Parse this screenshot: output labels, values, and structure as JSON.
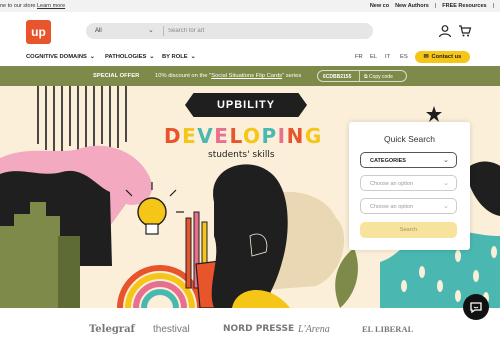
{
  "topbar": {
    "welcome": "ne to our store",
    "learn_more": "Learn more",
    "links": [
      "New co",
      "New Authors",
      "|",
      "FREE Resources",
      "|"
    ]
  },
  "header": {
    "logo": "up",
    "search": {
      "category": "All",
      "placeholder": "Search for art"
    },
    "icons": [
      "chevron-down-icon",
      "user-icon",
      "cart-icon"
    ]
  },
  "nav": {
    "items": [
      "COGNITIVE DOMAINS",
      "PATHOLOGIES",
      "BY ROLE"
    ],
    "languages": [
      "FR",
      "EL",
      "IT",
      "ES"
    ],
    "contact": "Contact us"
  },
  "offer": {
    "label": "SPECIAL OFFER",
    "text_prefix": "10% discount on the \"",
    "text_link": "Social Situations Flip Cards",
    "text_suffix": "\" series",
    "code": "6CDBB2155",
    "copy": "Copy code"
  },
  "hero": {
    "badge": "UPBILITY",
    "headline": "DEVELOPING",
    "subline": "students' skills",
    "headline_colors": [
      "#e8542c",
      "#f5c518",
      "#4bb7b1",
      "#e86f8e",
      "#e8542c",
      "#f5c518",
      "#4bb7b1",
      "#e86f8e",
      "#e8542c",
      "#f5c518"
    ]
  },
  "quick_search": {
    "title": "Quick Search",
    "category": "CATEGORIES",
    "option_1": "Choose an option",
    "option_2": "Choose an option",
    "button": "Search"
  },
  "press": [
    "Telegraf",
    "thestival",
    "NORD PRESSE",
    "L'Arena",
    "EL LIBERAL"
  ],
  "colors": {
    "brand": "#e8542c",
    "accent": "#f5c518",
    "offer_bg": "#7d8a49"
  }
}
